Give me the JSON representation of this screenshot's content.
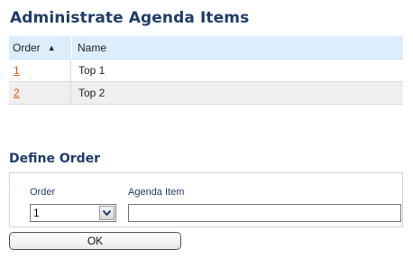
{
  "page": {
    "heading": "Administrate Agenda Items"
  },
  "table": {
    "columns": {
      "order": "Order",
      "name": "Name"
    },
    "sort_icon": "sort-up-triangle",
    "rows": [
      {
        "order": "1",
        "name": "Top 1"
      },
      {
        "order": "2",
        "name": "Top 2"
      }
    ]
  },
  "define_order": {
    "title": "Define Order",
    "order_label": "Order",
    "order_value": "1",
    "agenda_label": "Agenda Item",
    "agenda_value": "",
    "dropdown_icon": "chevron-down-icon"
  },
  "actions": {
    "ok_label": "OK"
  },
  "colors": {
    "heading": "#1f3d6b",
    "header_bg": "#dceefb",
    "link": "#e05a10",
    "row_alt": "#efefef"
  }
}
